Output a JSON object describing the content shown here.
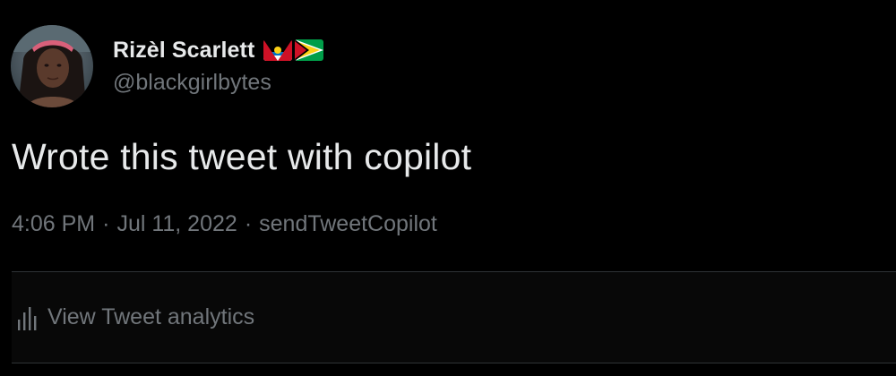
{
  "tweet": {
    "author": {
      "display_name": "Rizèl Scarlett",
      "handle": "@blackgirlbytes",
      "flags": [
        "antigua-and-barbuda-flag",
        "guyana-flag"
      ]
    },
    "text": "Wrote this tweet with copilot",
    "time": "4:06 PM",
    "date": "Jul 11, 2022",
    "source": "sendTweetCopilot",
    "separator": "·"
  },
  "analytics": {
    "icon": "bar-chart-icon",
    "label": "View Tweet analytics"
  },
  "colors": {
    "background": "#000000",
    "primary_text": "#e7e9ea",
    "secondary_text": "#71767b",
    "divider": "#2f3336"
  }
}
